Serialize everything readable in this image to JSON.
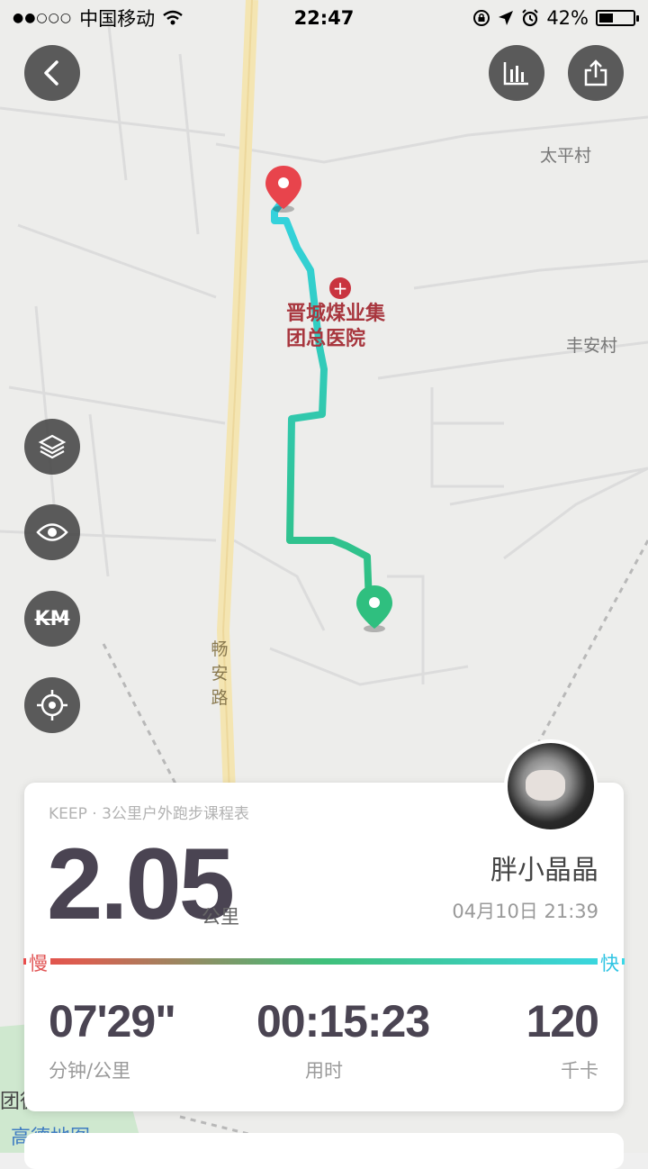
{
  "status_bar": {
    "carrier": "中国移动",
    "time": "22:47",
    "battery": "42%",
    "battery_level": 0.42
  },
  "map": {
    "labels": {
      "village1": "太平村",
      "village2": "丰安村",
      "road": [
        "畅",
        "安",
        "路"
      ],
      "hospital_line1": "晋城煤业集",
      "hospital_line2": "团总医院",
      "partial": "团徒",
      "amap": "高德地图"
    }
  },
  "icons": {
    "back": "back-arrow-icon",
    "chart": "bar-chart-icon",
    "share": "share-icon",
    "layers": "layers-icon",
    "eye": "eye-icon",
    "km": "km-toggle-icon",
    "locate": "locate-icon"
  },
  "controls": {
    "km_label": "KM"
  },
  "colors": {
    "track_start": "#2fbf7f",
    "track_end": "#34d3e0",
    "start_pin": "#2fbf7f",
    "end_pin": "#e8444c",
    "slow": "#e15454",
    "fast": "#2fc4e3"
  },
  "summary": {
    "source": "KEEP · 3公里户外跑步课程表",
    "distance": "2.05",
    "distance_unit": "公里",
    "user_name": "胖小晶晶",
    "date": "04月10日 21:39",
    "slow_label": "慢",
    "fast_label": "快",
    "stats": [
      {
        "value": "07'29\"",
        "label": "分钟/公里"
      },
      {
        "value": "00:15:23",
        "label": "用时"
      },
      {
        "value": "120",
        "label": "千卡"
      }
    ]
  }
}
